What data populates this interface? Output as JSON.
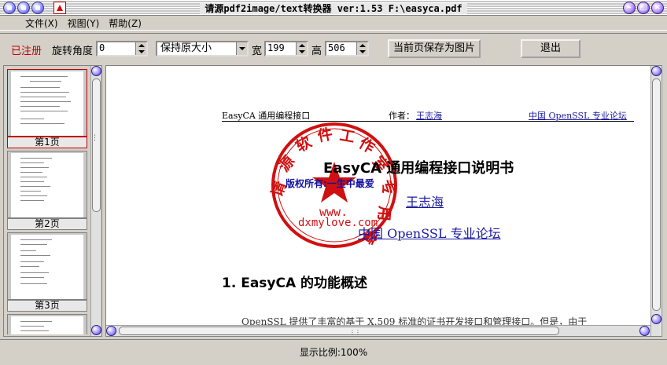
{
  "window": {
    "title": "请源pdf2image/text转换器 ver:1.53 F:\\easyca.pdf"
  },
  "menu": {
    "items": [
      "文件(X)",
      "视图(Y)",
      "帮助(Z)"
    ]
  },
  "toolbar": {
    "registered_label": "已注册",
    "rotate_label": "旋转角度",
    "rotate_value": "0",
    "size_mode": "保持原大小",
    "width_label": "宽",
    "width_value": "199",
    "height_label": "高",
    "height_value": "506",
    "save_page_button": "当前页保存为图片",
    "exit_button": "退出"
  },
  "thumbnails": [
    {
      "label": "第1页",
      "selected": true
    },
    {
      "label": "第2页",
      "selected": false
    },
    {
      "label": "第3页",
      "selected": false
    }
  ],
  "document": {
    "header_left": "EasyCA 通用编程接口",
    "header_author_label": "作者：",
    "header_author": "王志海",
    "header_right": "中国 OpenSSL 专业论坛",
    "title": "EasyCA 通用编程接口说明书",
    "author": "王志海",
    "forum": "中国 OpenSSL 专业论坛",
    "section_title": "1.  EasyCA 的功能概述",
    "paragraph_start": "OpenSSL 提供了丰富的基于 X.509 标准的证书开发接口和管理接口。但是，由于"
  },
  "stamp": {
    "ring_text": "请源软件工作室专用章",
    "watermark": "版权所有:一生中最爱",
    "url_line1": "www.",
    "url_line2": "dxmylove.com"
  },
  "status": {
    "zoom_text": "显示比例:100%"
  },
  "colors": {
    "registered": "#c00000",
    "stamp": "#d01010",
    "link": "#1a1aa0"
  }
}
